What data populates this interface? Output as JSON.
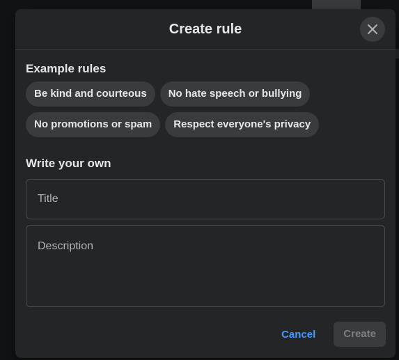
{
  "dialog": {
    "title": "Create rule",
    "close_icon": "close-icon"
  },
  "examples": {
    "label": "Example rules",
    "chips": [
      "Be kind and courteous",
      "No hate speech or bullying",
      "No promotions or spam",
      "Respect everyone's privacy"
    ]
  },
  "custom": {
    "label": "Write your own",
    "title_placeholder": "Title",
    "description_placeholder": "Description"
  },
  "footer": {
    "cancel_label": "Cancel",
    "create_label": "Create"
  },
  "colors": {
    "dialog_bg": "#242526",
    "chip_bg": "#3a3b3c",
    "link": "#4599ff",
    "text": "#e4e6eb"
  }
}
